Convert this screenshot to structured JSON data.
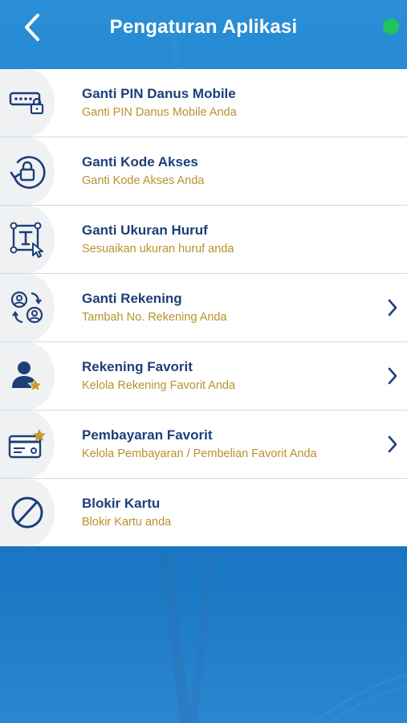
{
  "header": {
    "title": "Pengaturan Aplikasi",
    "status_color": "#21c35a"
  },
  "colors": {
    "accent_blue": "#1f7fcb",
    "title_navy": "#1d3f78",
    "subtitle_gold": "#b8922b"
  },
  "menu": {
    "items": [
      {
        "icon": "pin-keypad-lock-icon",
        "title": "Ganti PIN Danus Mobile",
        "subtitle": "Ganti PIN Danus Mobile Anda",
        "has_chevron": false
      },
      {
        "icon": "rotate-lock-icon",
        "title": "Ganti Kode Akses",
        "subtitle": "Ganti Kode Akses Anda",
        "has_chevron": false
      },
      {
        "icon": "text-size-cursor-icon",
        "title": "Ganti Ukuran Huruf",
        "subtitle": "Sesuaikan ukuran huruf anda",
        "has_chevron": false
      },
      {
        "icon": "switch-account-icon",
        "title": "Ganti Rekening",
        "subtitle": "Tambah No. Rekening Anda",
        "has_chevron": true
      },
      {
        "icon": "user-star-icon",
        "title": "Rekening Favorit",
        "subtitle": "Kelola Rekening Favorit Anda",
        "has_chevron": true
      },
      {
        "icon": "card-star-icon",
        "title": "Pembayaran Favorit",
        "subtitle": "Kelola Pembayaran / Pembelian Favorit Anda",
        "has_chevron": true
      },
      {
        "icon": "block-icon",
        "title": "Blokir Kartu",
        "subtitle": "Blokir Kartu anda",
        "has_chevron": false
      }
    ]
  }
}
